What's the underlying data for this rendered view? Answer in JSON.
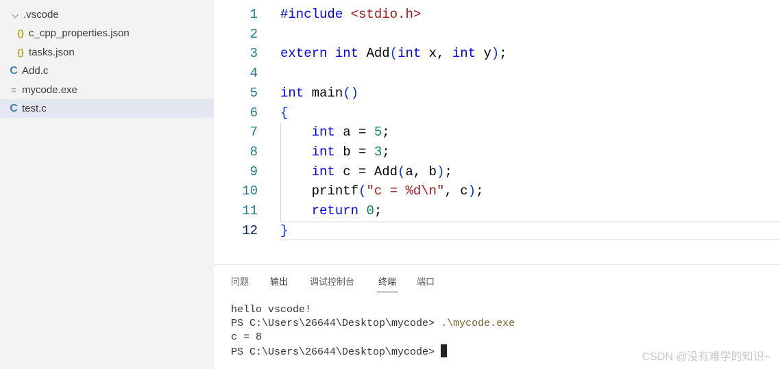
{
  "explorer": {
    "items": [
      {
        "label": ".vscode",
        "icon": "chevron-down-icon",
        "indent": 1
      },
      {
        "label": "c_cpp_properties.json",
        "icon": "json-icon",
        "indent": 2
      },
      {
        "label": "tasks.json",
        "icon": "json-icon",
        "indent": 2
      },
      {
        "label": "Add.c",
        "icon": "c-file-icon",
        "indent": 0
      },
      {
        "label": "mycode.exe",
        "icon": "file-icon",
        "indent": 0
      },
      {
        "label": "test.c",
        "icon": "c-file-icon",
        "indent": 0,
        "selected": true
      }
    ]
  },
  "editor": {
    "current_line": 12,
    "lines": [
      [
        [
          "kw",
          "#include"
        ],
        [
          "pl",
          " "
        ],
        [
          "str",
          "<stdio.h>"
        ]
      ],
      [],
      [
        [
          "kw",
          "extern"
        ],
        [
          "pl",
          " "
        ],
        [
          "kw",
          "int"
        ],
        [
          "pl",
          " Add"
        ],
        [
          "br",
          "("
        ],
        [
          "kw",
          "int"
        ],
        [
          "pl",
          " x, "
        ],
        [
          "kw",
          "int"
        ],
        [
          "pl",
          " y"
        ],
        [
          "br",
          ")"
        ],
        [
          "pl",
          ";"
        ]
      ],
      [],
      [
        [
          "kw",
          "int"
        ],
        [
          "pl",
          " main"
        ],
        [
          "br",
          "()"
        ]
      ],
      [
        [
          "br",
          "{"
        ]
      ],
      [
        [
          "pl",
          "    "
        ],
        [
          "kw",
          "int"
        ],
        [
          "pl",
          " a = "
        ],
        [
          "num",
          "5"
        ],
        [
          "pl",
          ";"
        ]
      ],
      [
        [
          "pl",
          "    "
        ],
        [
          "kw",
          "int"
        ],
        [
          "pl",
          " b = "
        ],
        [
          "num",
          "3"
        ],
        [
          "pl",
          ";"
        ]
      ],
      [
        [
          "pl",
          "    "
        ],
        [
          "kw",
          "int"
        ],
        [
          "pl",
          " c = Add"
        ],
        [
          "br",
          "("
        ],
        [
          "pl",
          "a, b"
        ],
        [
          "br",
          ")"
        ],
        [
          "pl",
          ";"
        ]
      ],
      [
        [
          "pl",
          "    printf"
        ],
        [
          "br",
          "("
        ],
        [
          "str",
          "\"c = %d\\n\""
        ],
        [
          "pl",
          ", c"
        ],
        [
          "br",
          ")"
        ],
        [
          "pl",
          ";"
        ]
      ],
      [
        [
          "pl",
          "    "
        ],
        [
          "kw",
          "return"
        ],
        [
          "pl",
          " "
        ],
        [
          "num",
          "0"
        ],
        [
          "pl",
          ";"
        ]
      ],
      [
        [
          "br",
          "}"
        ]
      ]
    ]
  },
  "panel": {
    "tabs": [
      "问题",
      "输出",
      "调试控制台",
      "终端",
      "端口"
    ],
    "active_tab": "终端"
  },
  "terminal": {
    "line1": "hello vscode!",
    "prompt": "PS C:\\Users\\26644\\Desktop\\mycode> ",
    "command": ".\\mycode.exe",
    "line3": "c = 8"
  },
  "watermark": "CSDN @没有难学的知识~",
  "colors": {
    "keyword": "#0000ff",
    "string": "#a31515",
    "number": "#098658",
    "bracket": "#0431fa",
    "line_number": "#237893"
  }
}
